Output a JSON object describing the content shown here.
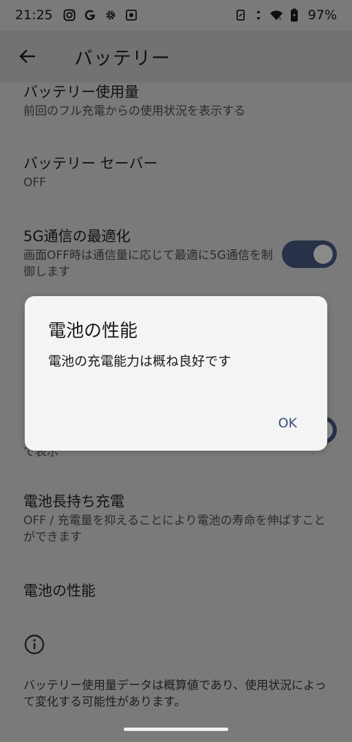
{
  "status_bar": {
    "time": "21:25",
    "battery_percent": "97%"
  },
  "app_bar": {
    "title": "バッテリー"
  },
  "prefs": {
    "battery_usage": {
      "title": "バッテリー使用量",
      "summary": "前回のフル充電からの使用状況を表示する"
    },
    "battery_saver": {
      "title": "バッテリー セーバー",
      "summary": "OFF"
    },
    "optimize_5g": {
      "title": "5G通信の最適化",
      "summary": "画面OFF時は通信量に応じて最適に5G通信を制御します",
      "enabled": true
    },
    "hidden_pref": {
      "summary_tail": "で表示"
    },
    "long_life_charge": {
      "title": "電池長持ち充電",
      "summary": "OFF / 充電量を抑えることにより電池の寿命を伸ばすことができます"
    },
    "battery_performance": {
      "title": "電池の性能"
    }
  },
  "footer": {
    "text": "バッテリー使用量データは概算値であり、使用状況によって変化する可能性があります。"
  },
  "dialog": {
    "title": "電池の性能",
    "message": "電池の充電能力は概ね良好です",
    "ok_label": "OK"
  },
  "colors": {
    "scrim_bg": "#7a7a7a",
    "dialog_bg": "#f4f4f4",
    "switch_track": "#273148",
    "ok_text": "#3a4e7a"
  }
}
